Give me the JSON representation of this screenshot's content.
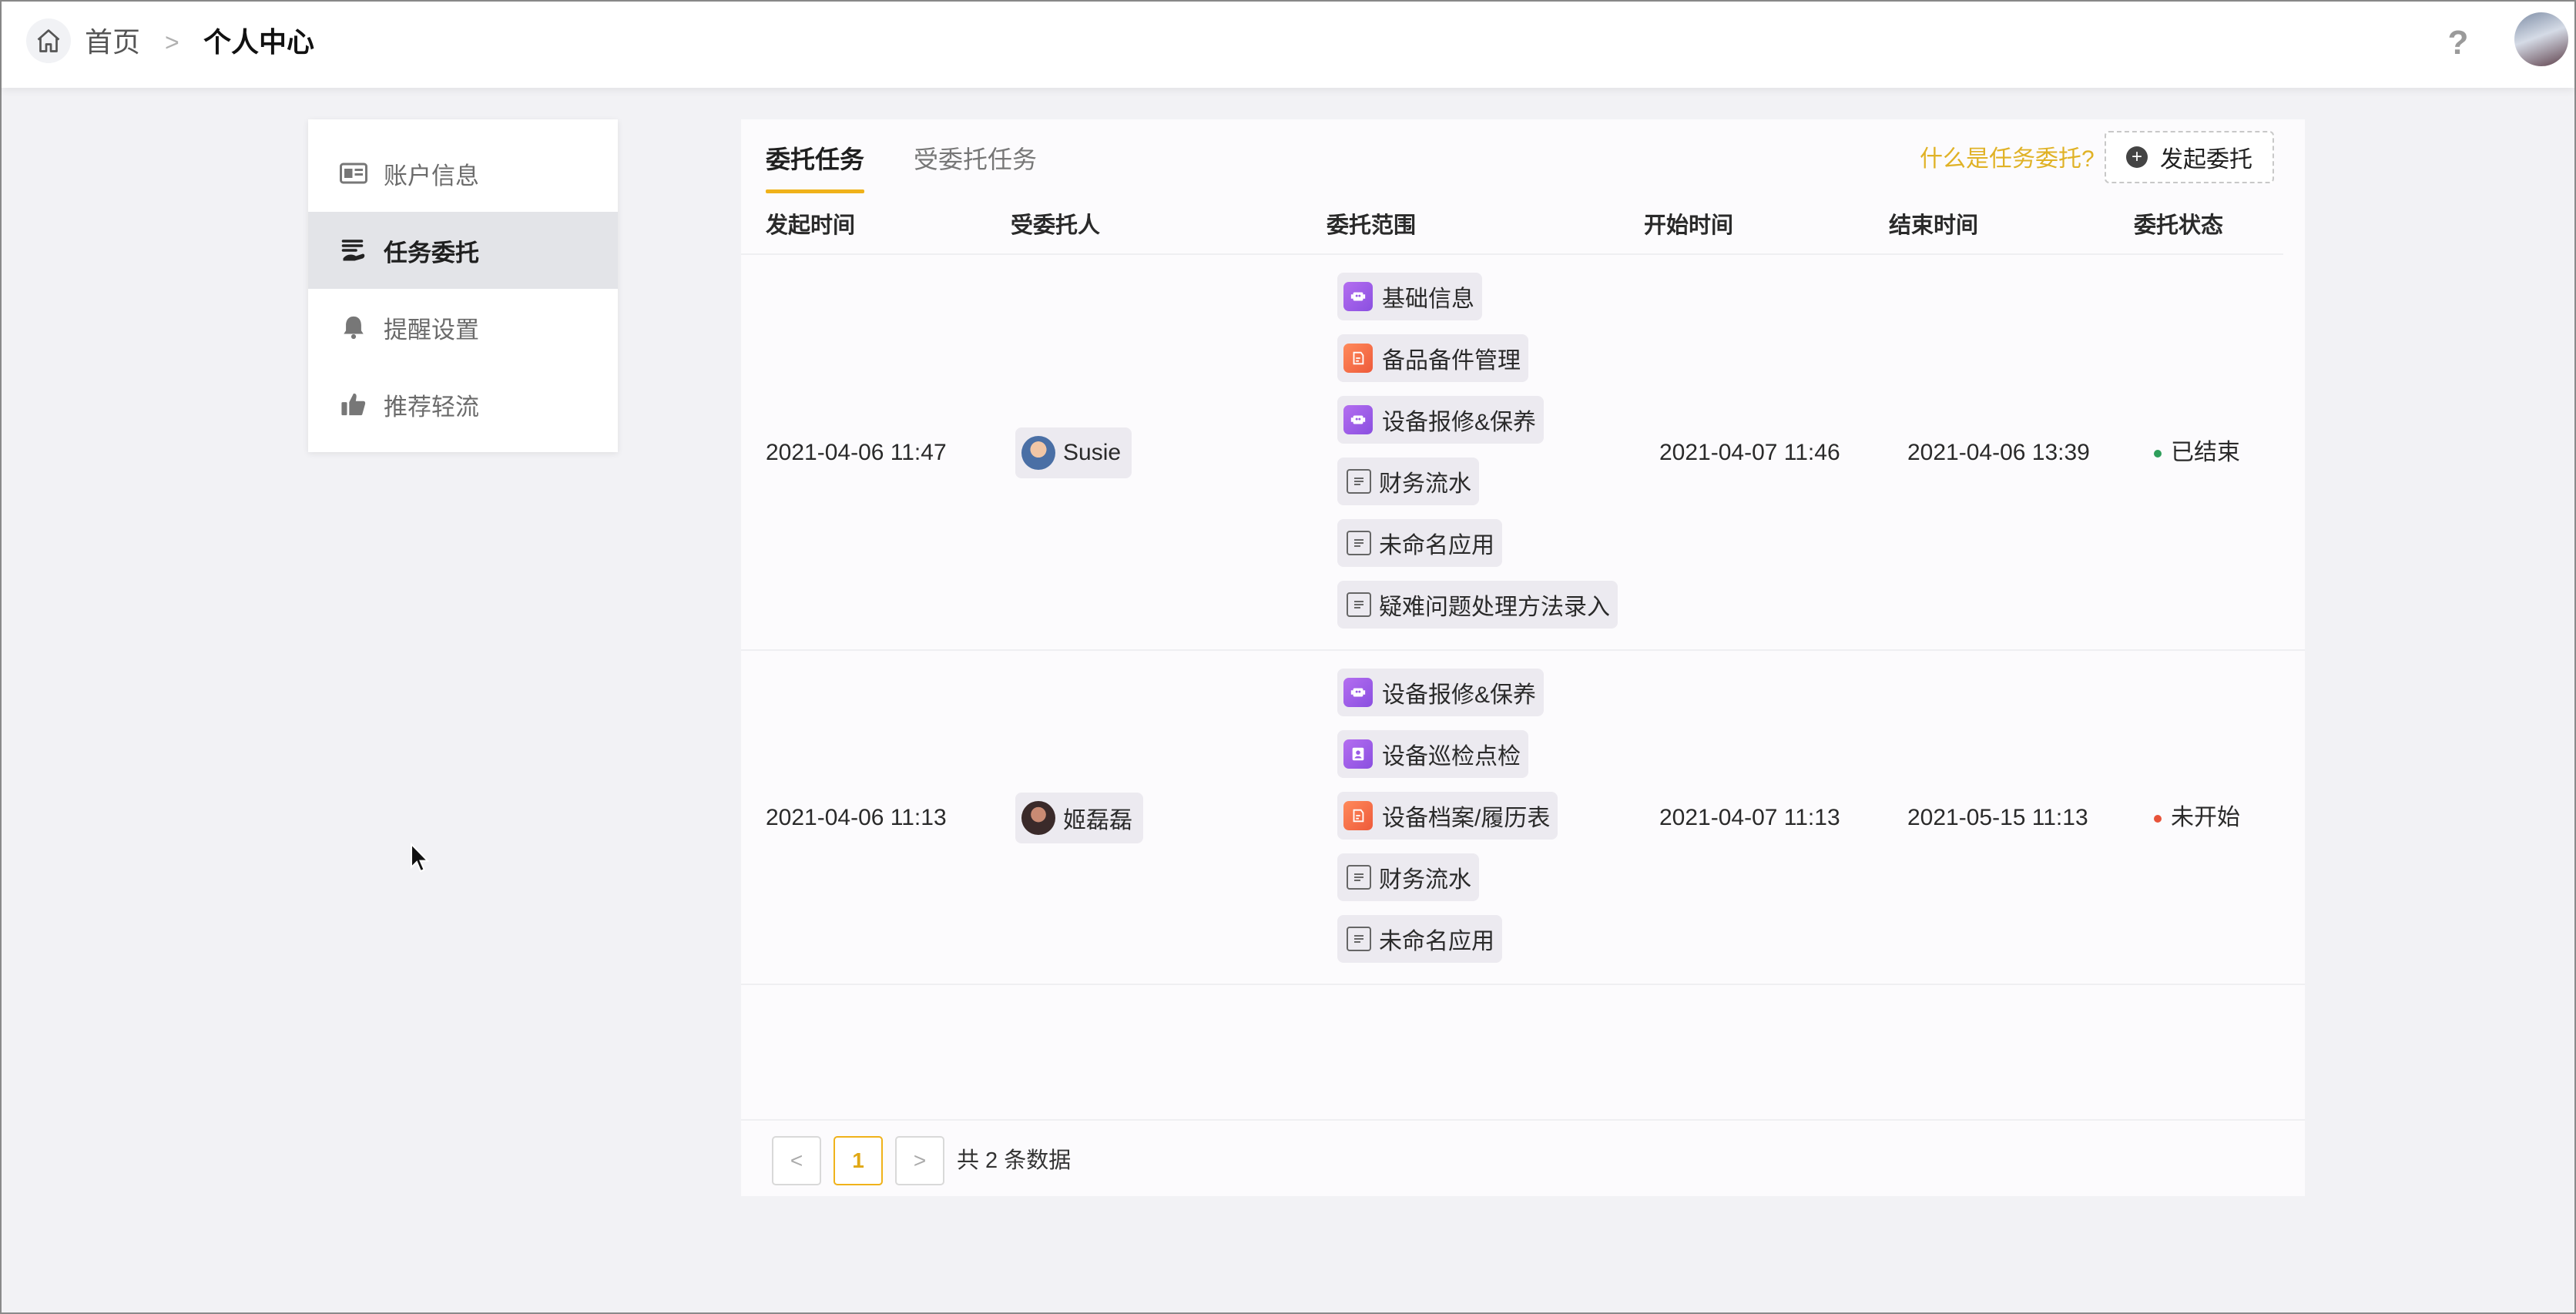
{
  "breadcrumb": {
    "home": "首页",
    "separator": ">",
    "current": "个人中心"
  },
  "header": {
    "help": "?"
  },
  "sidebar": {
    "items": [
      {
        "label": "账户信息",
        "icon": "id-card-icon",
        "active": false
      },
      {
        "label": "任务委托",
        "icon": "hand-delegate-icon",
        "active": true
      },
      {
        "label": "提醒设置",
        "icon": "bell-icon",
        "active": false
      },
      {
        "label": "推荐轻流",
        "icon": "thumbs-up-icon",
        "active": false
      }
    ]
  },
  "tabs": [
    {
      "label": "委托任务",
      "active": true
    },
    {
      "label": "受委托任务",
      "active": false
    }
  ],
  "toolbar": {
    "what_link": "什么是任务委托?",
    "start_button": "发起委托"
  },
  "table": {
    "headers": [
      "发起时间",
      "受委托人",
      "委托范围",
      "开始时间",
      "结束时间",
      "委托状态"
    ],
    "rows": [
      {
        "created": "2021-04-06 11:47",
        "delegate": "Susie",
        "scope": [
          {
            "label": "基础信息",
            "icon": "app-icon-purple"
          },
          {
            "label": "备品备件管理",
            "icon": "app-icon-orange"
          },
          {
            "label": "设备报修&保养",
            "icon": "app-icon-purple"
          },
          {
            "label": "财务流水",
            "icon": "form-doc-icon"
          },
          {
            "label": "未命名应用",
            "icon": "form-doc-icon"
          },
          {
            "label": "疑难问题处理方法录入",
            "icon": "form-doc-icon"
          }
        ],
        "start": "2021-04-07 11:46",
        "end": "2021-04-06 13:39",
        "status": "已结束",
        "status_color": "#2e9e5b"
      },
      {
        "created": "2021-04-06 11:13",
        "delegate": "姬磊磊",
        "scope": [
          {
            "label": "设备报修&保养",
            "icon": "app-icon-purple"
          },
          {
            "label": "设备巡检点检",
            "icon": "app-icon-purple"
          },
          {
            "label": "设备档案/履历表",
            "icon": "app-icon-orange"
          },
          {
            "label": "财务流水",
            "icon": "form-doc-icon"
          },
          {
            "label": "未命名应用",
            "icon": "form-doc-icon"
          }
        ],
        "start": "2021-04-07 11:13",
        "end": "2021-05-15 11:13",
        "status": "未开始",
        "status_color": "#e8533a"
      }
    ]
  },
  "pagination": {
    "prev": "<",
    "current_page": "1",
    "next": ">",
    "total": "共 2 条数据"
  },
  "colors": {
    "accent": "#f0b21a",
    "link": "#e0b226"
  }
}
